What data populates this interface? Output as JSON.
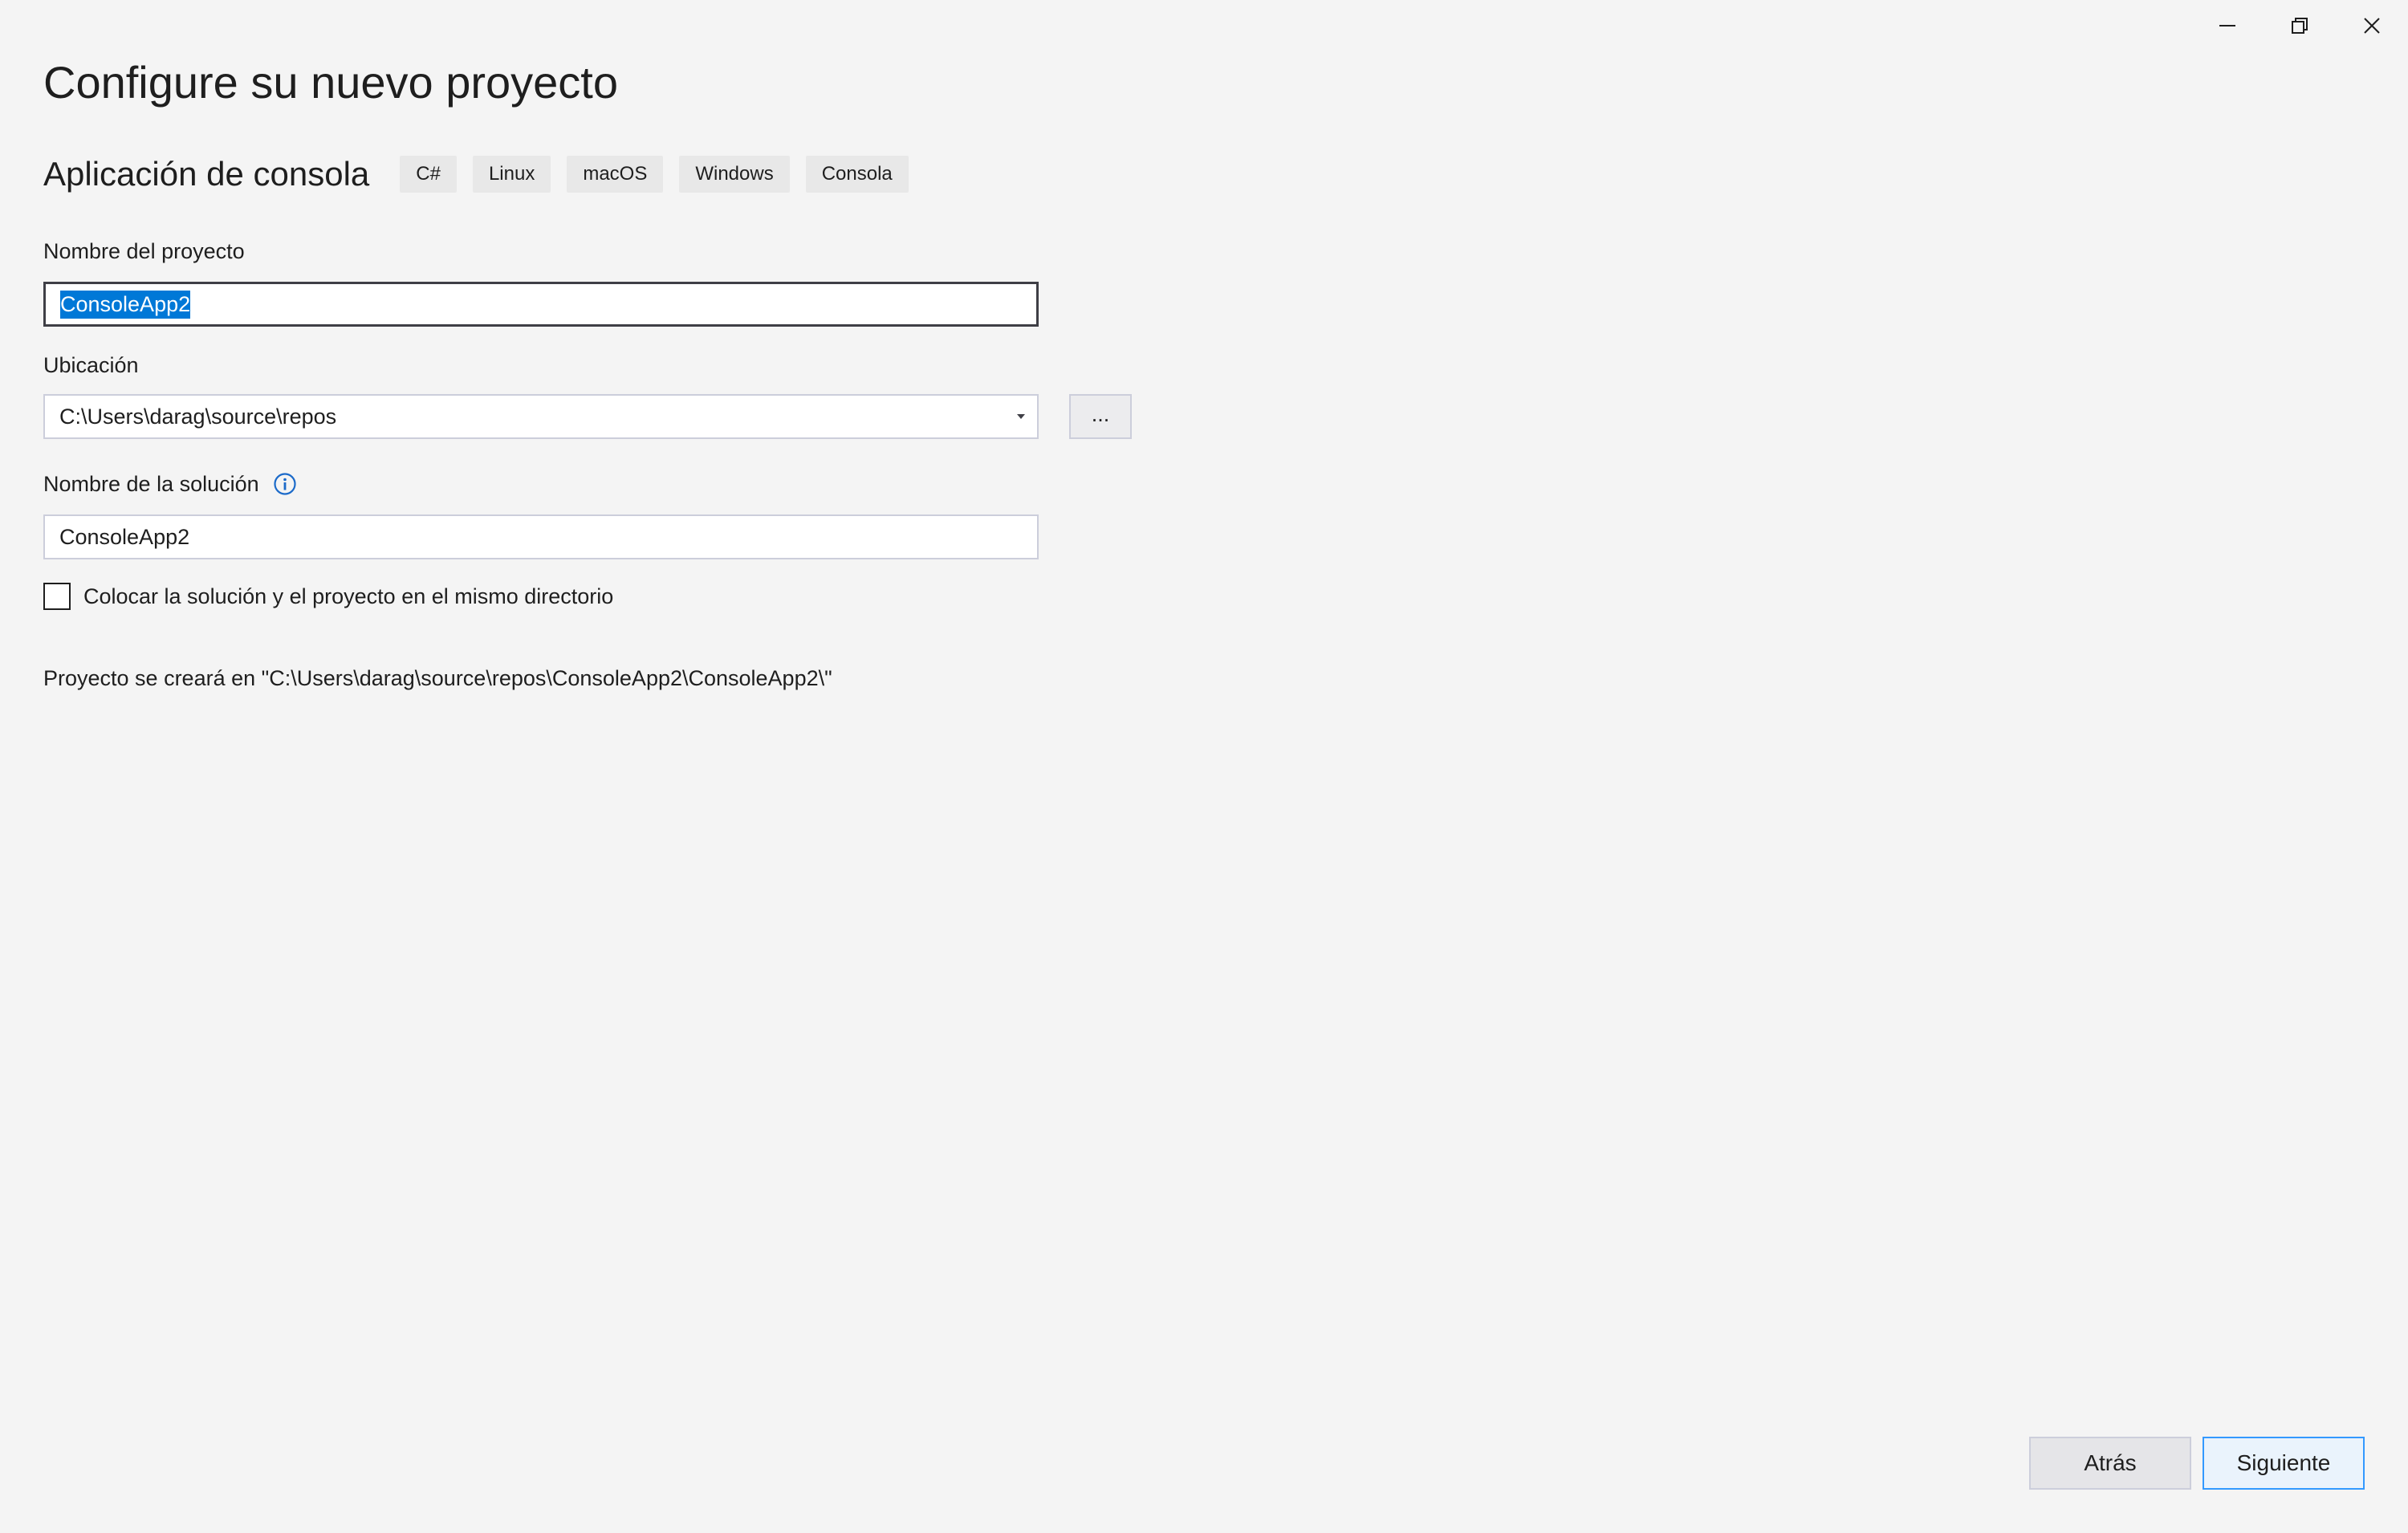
{
  "window": {
    "controls": {
      "minimize_icon": "minimize-icon",
      "restore_icon": "restore-icon",
      "close_icon": "close-icon"
    }
  },
  "page": {
    "title": "Configure su nuevo proyecto"
  },
  "template": {
    "name": "Aplicación de consola",
    "tags": [
      "C#",
      "Linux",
      "macOS",
      "Windows",
      "Consola"
    ]
  },
  "form": {
    "project_name": {
      "label": "Nombre del proyecto",
      "value": "ConsoleApp2"
    },
    "location": {
      "label": "Ubicación",
      "value": "C:\\Users\\darag\\source\\repos",
      "browse_label": "..."
    },
    "solution_name": {
      "label": "Nombre de la solución",
      "value": "ConsoleApp2",
      "info_icon": "info-icon"
    },
    "same_directory": {
      "label": "Colocar la solución y el proyecto en el mismo directorio",
      "checked": false
    },
    "path_preview": "Proyecto se creará en \"C:\\Users\\darag\\source\\repos\\ConsoleApp2\\ConsoleApp2\\\""
  },
  "footer": {
    "back_label": "Atrás",
    "next_label": "Siguiente"
  },
  "colors": {
    "background": "#f4f4f4",
    "selection": "#0078d7",
    "info_accent": "#1b6ac9",
    "primary_border": "#3399ff"
  }
}
